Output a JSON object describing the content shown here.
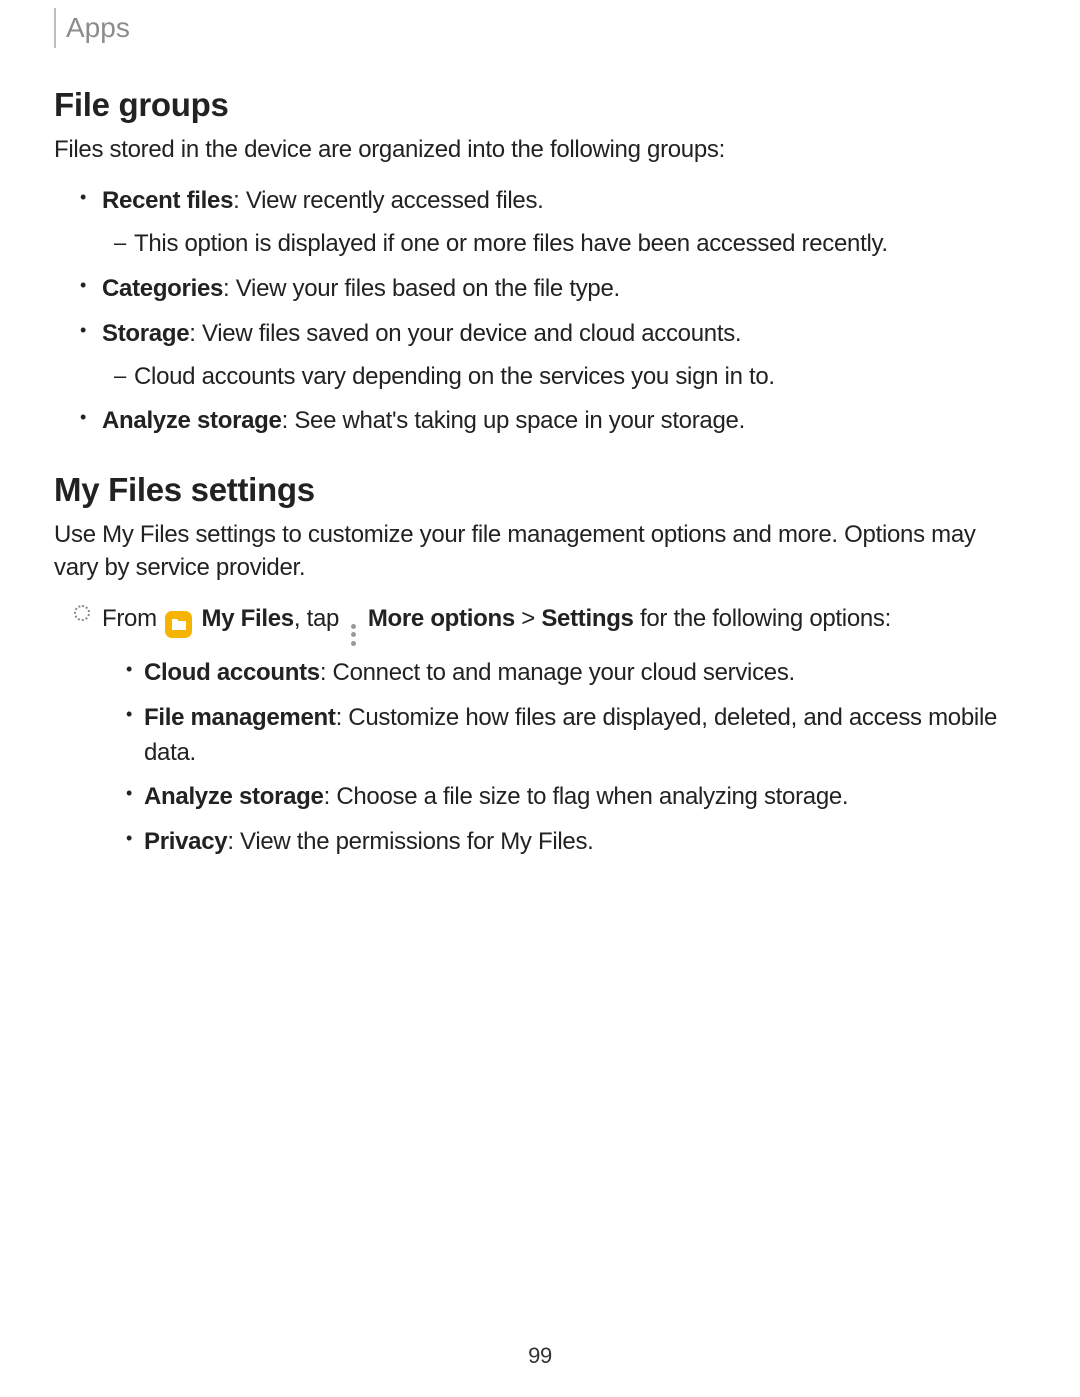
{
  "breadcrumb": "Apps",
  "section1": {
    "title": "File groups",
    "lead": "Files stored in the device are organized into the following groups:",
    "items": {
      "recent": {
        "label": "Recent files",
        "desc": ": View recently accessed files.",
        "sub": "This option is displayed if one or more files have been accessed recently."
      },
      "categories": {
        "label": "Categories",
        "desc": ": View your files based on the file type."
      },
      "storage": {
        "label": "Storage",
        "desc": ": View files saved on your device and cloud accounts.",
        "sub": "Cloud accounts vary depending on the services you sign in to."
      },
      "analyze": {
        "label": "Analyze storage",
        "desc": ": See what's taking up space in your storage."
      }
    }
  },
  "section2": {
    "title": "My Files settings",
    "lead": "Use My Files settings to customize your file management options and more. Options may vary by service provider.",
    "from": {
      "pre": "From ",
      "app": "My Files",
      "mid": ", tap ",
      "more": "More options",
      "gt": " > ",
      "settings": "Settings",
      "post": " for the following options:"
    },
    "items": {
      "cloud": {
        "label": "Cloud accounts",
        "desc": ": Connect to and manage your cloud services."
      },
      "filemgmt": {
        "label": "File management",
        "desc": ": Customize how files are displayed, deleted, and access mobile data."
      },
      "analyze": {
        "label": "Analyze storage",
        "desc": ": Choose a file size to flag when analyzing storage."
      },
      "privacy": {
        "label": "Privacy",
        "desc": ": View the permissions for My Files."
      }
    }
  },
  "page_number": "99"
}
